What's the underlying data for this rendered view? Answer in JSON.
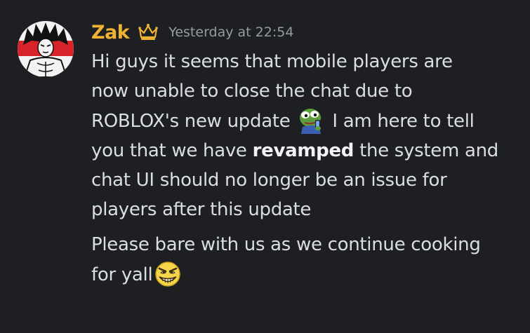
{
  "author": {
    "username": "Zak",
    "name_color": "#f0b232",
    "badge_icon": "crown-icon",
    "badge_color": "#f0b232"
  },
  "timestamp": "Yesterday at 22:54",
  "message": {
    "paragraph1": {
      "line1": "Hi guys it seems that mobile players are",
      "line2": "now unable to close the chat due to",
      "line3_before_emoji": "ROBLOX's new update",
      "line3_after_emoji": "I am here to tell",
      "line4_before_bold": "you that we have",
      "line4_bold": "revamped",
      "line4_after_bold": "the system and",
      "line5": "chat UI should no longer be an issue for",
      "line6": "players after this update"
    },
    "paragraph2": {
      "line1": "Please bare with us as we continue cooking",
      "line2": "for yall"
    },
    "emojis": [
      "pepe-frog-emoji",
      "grinning-evil-face-emoji"
    ]
  },
  "colors": {
    "background": "#1e1f22",
    "text": "#dbdee1",
    "muted": "#949ba4"
  }
}
